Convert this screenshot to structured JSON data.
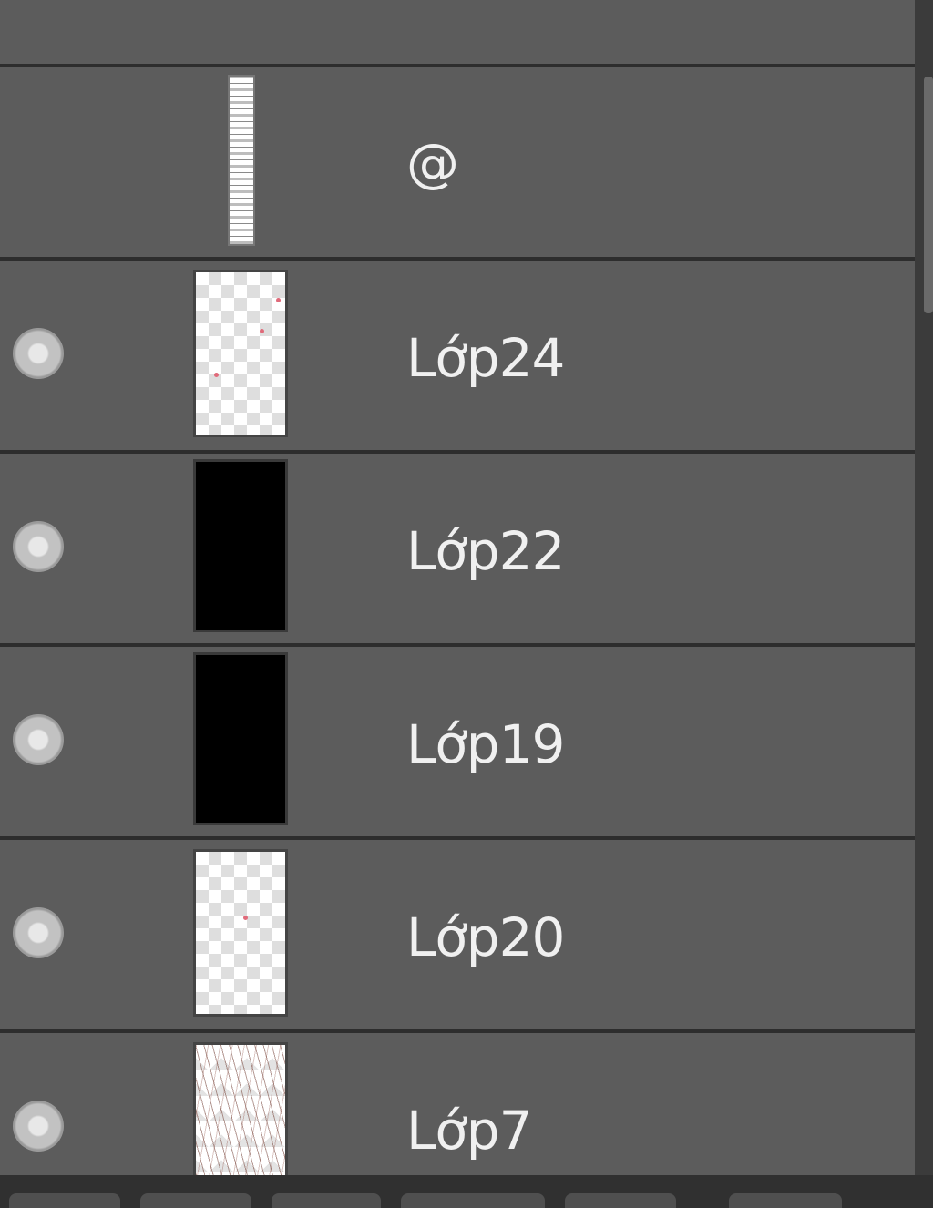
{
  "layers_panel": {
    "layers": [
      {
        "name": "",
        "thumbnail": "partial",
        "visible_toggle": false
      },
      {
        "name": "@",
        "thumbnail": "narrow-strip",
        "visible_toggle": false
      },
      {
        "name": "Lớp24",
        "thumbnail": "transparent-checker",
        "visible_toggle": true
      },
      {
        "name": "Lớp22",
        "thumbnail": "black",
        "visible_toggle": true
      },
      {
        "name": "Lớp19",
        "thumbnail": "black",
        "visible_toggle": true
      },
      {
        "name": "Lớp20",
        "thumbnail": "transparent-checker",
        "visible_toggle": true
      },
      {
        "name": "Lớp7",
        "thumbnail": "sketch",
        "visible_toggle": true
      }
    ]
  },
  "colors": {
    "panel_bg": "#5c5c5c",
    "row_divider": "#2d2d2d",
    "text": "#f0f0f0"
  },
  "icons": {
    "visibility": "visibility-dot-icon"
  }
}
